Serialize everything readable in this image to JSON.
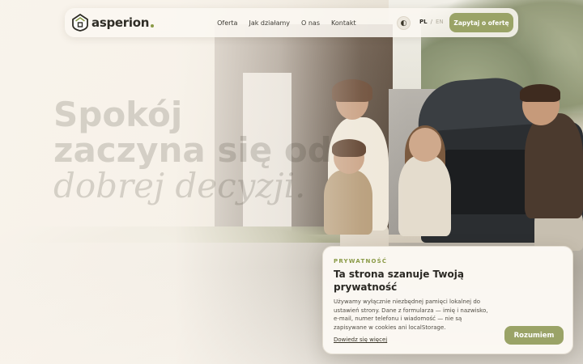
{
  "nav": {
    "logo_text": "asperion",
    "links": [
      "Oferta",
      "Jak działamy",
      "O nas",
      "Kontakt"
    ],
    "theme_toggle_icon": "◐",
    "lang_active": "PL",
    "lang_separator": "/",
    "lang_inactive": "EN",
    "cta_label": "Zapytaj o ofertę"
  },
  "hero": {
    "headline_bold": "Spokój zaczyna się od",
    "headline_italic": "dobrej decyzji."
  },
  "cookie": {
    "eyebrow": "PRYWATNOŚĆ",
    "title": "Ta strona szanuje Twoją prywatność",
    "body": "Używamy wyłącznie niezbędnej pamięci lokalnej do ustawień strony. Dane z formularza — imię i nazwisko, e-mail, numer telefonu i wiadomość — nie są zapisywane w cookies ani localStorage.",
    "link": "Dowiedz się więcej",
    "accept": "Rozumiem"
  },
  "colors": {
    "accent": "#9aa367",
    "accent_dark": "#8a9a46",
    "text_dark": "#2b2924",
    "background": "#f9f4ec"
  },
  "icons": {
    "logo": "house-shield-icon",
    "theme": "contrast-icon"
  }
}
